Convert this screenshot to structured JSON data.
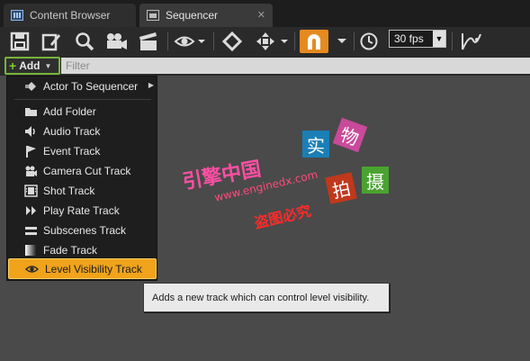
{
  "tabs": [
    {
      "label": "Content Browser",
      "icon": "content-browser-icon",
      "active": false
    },
    {
      "label": "Sequencer",
      "icon": "sequencer-icon",
      "active": true,
      "close": "✕"
    }
  ],
  "toolbar": {
    "icons": [
      "save-icon",
      "save-as-icon",
      "find-icon",
      "camera-icon",
      "render-movie-icon",
      "view-options-icon",
      "key-icon",
      "transform-icon",
      "snap-magnet-icon",
      "clock-icon",
      "curve-editor-icon"
    ],
    "fps": "30 fps",
    "accent": "#e58a1f"
  },
  "filter": {
    "add_label": "Add",
    "placeholder": "Filter",
    "add_accent": "#78b43a"
  },
  "menu": {
    "items": [
      {
        "label": "Actor To Sequencer",
        "icon": "actor-icon",
        "has_submenu": true
      },
      {
        "label": "Add Folder",
        "icon": "folder-icon"
      },
      {
        "label": "Audio Track",
        "icon": "speaker-icon"
      },
      {
        "label": "Event Track",
        "icon": "flag-icon"
      },
      {
        "label": "Camera Cut Track",
        "icon": "camera-cut-icon"
      },
      {
        "label": "Shot Track",
        "icon": "film-icon"
      },
      {
        "label": "Play Rate Track",
        "icon": "play-rate-icon"
      },
      {
        "label": "Subscenes Track",
        "icon": "subscenes-icon"
      },
      {
        "label": "Fade Track",
        "icon": "fade-icon"
      },
      {
        "label": "Level Visibility Track",
        "icon": "eye-icon",
        "highlighted": true
      }
    ],
    "highlight_color": "#f0a31b"
  },
  "tooltip": {
    "text": "Adds a new track which can control level visibility."
  },
  "watermark": {
    "title": "引擎中国",
    "url": "www.enginedx.com",
    "subtitle": "盗图必究",
    "chars": [
      {
        "text": "实",
        "color": "#1b7fb6"
      },
      {
        "text": "物",
        "color": "#c94a9a"
      },
      {
        "text": "拍",
        "color": "#c0391c"
      },
      {
        "text": "摄",
        "color": "#4aa330"
      }
    ]
  }
}
